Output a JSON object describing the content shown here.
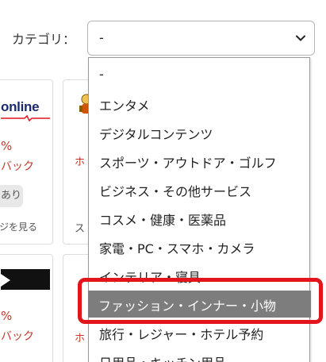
{
  "filter": {
    "label": "カテゴリ：",
    "selected": "-"
  },
  "dropdown": {
    "options": [
      "-",
      "エンタメ",
      "デジタルコンテンツ",
      "スポーツ・アウトドア・ゴルフ",
      "ビジネス・その他サービス",
      "コスメ・健康・医薬品",
      "家電・PC・スマホ・カメラ",
      "インテリア・寝具",
      "ファッション・インナー・小物",
      "旅行・レジャー・ホテル予約",
      "日用品・キッチン用品"
    ],
    "highlighted_index": 8
  },
  "cards": {
    "a": {
      "logo": "online",
      "pct": "%",
      "back": "バック",
      "pill": "あり",
      "see_more": "ジを見る"
    },
    "b": {
      "edge_red": "ホ",
      "edge_grey": "ス"
    },
    "c": {
      "pct": "%",
      "back": "バック"
    },
    "d": {
      "edge_red": "ホ"
    }
  },
  "colors": {
    "accent_red": "#e3141c",
    "highlight_bg": "#7d7d7d",
    "cashback_red": "#c0392b",
    "logo_navy": "#1a2a6c"
  }
}
